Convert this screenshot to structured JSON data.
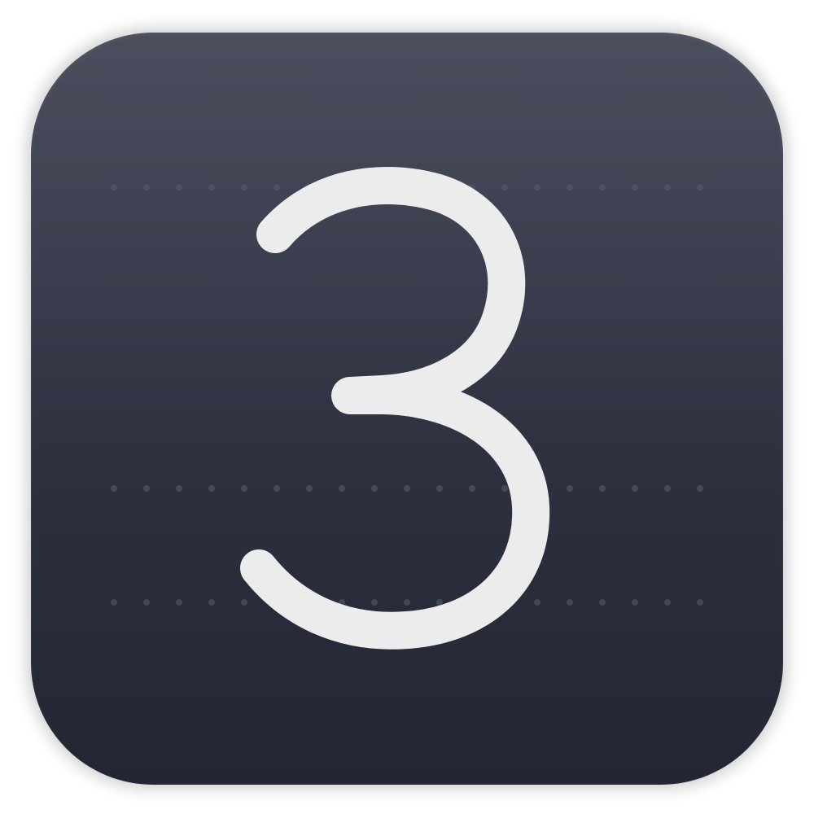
{
  "icon": {
    "name": "number-3-icon",
    "digit": "3",
    "colors": {
      "background_top": "#434757",
      "background_bottom": "#232633",
      "digit": "#ececec",
      "dots": "#5a5e6e"
    }
  }
}
